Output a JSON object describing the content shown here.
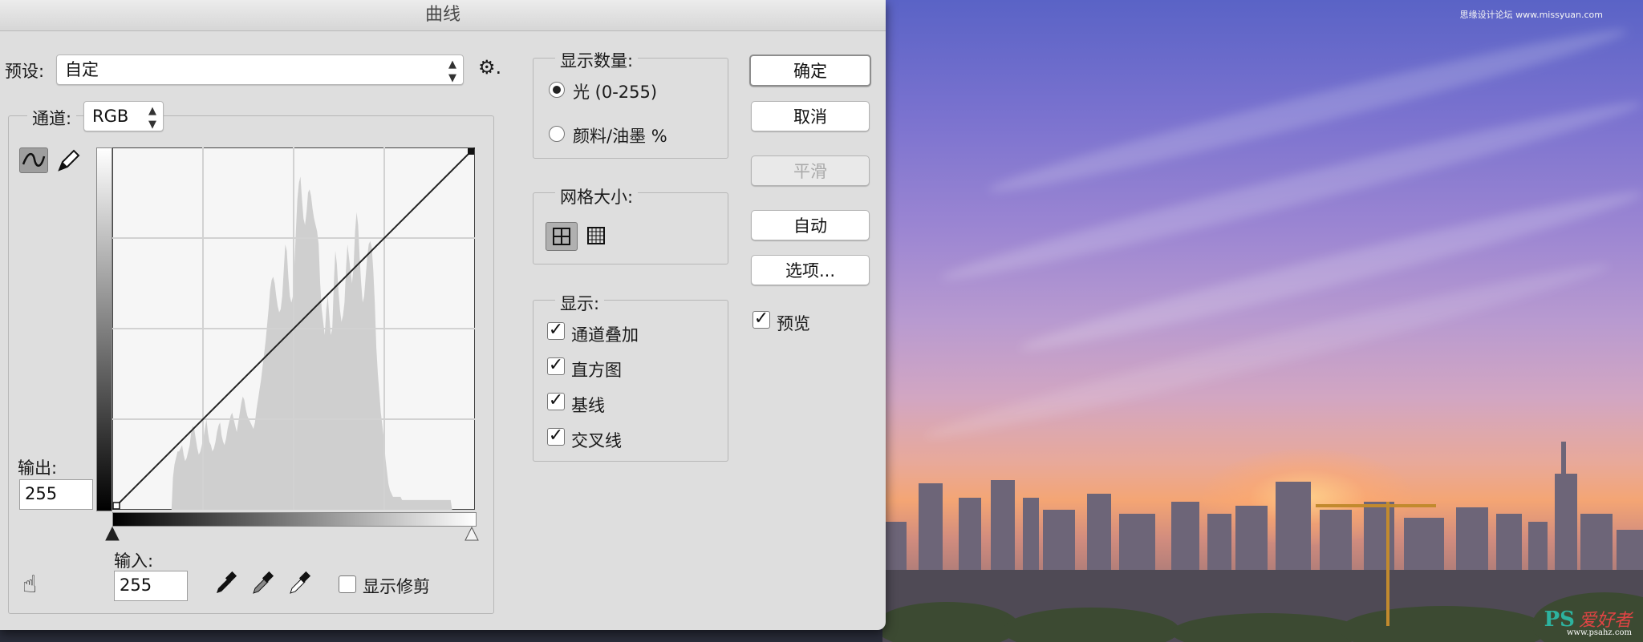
{
  "dialog": {
    "title": "曲线",
    "preset_label": "预设:",
    "preset_value": "自定",
    "channel_label": "通道:",
    "channel_value": "RGB",
    "output_label": "输出:",
    "output_value": "255",
    "input_label": "输入:",
    "input_value": "255",
    "show_clipping_label": "显示修剪",
    "show_clipping_checked": false
  },
  "display_amount": {
    "title": "显示数量:",
    "options": [
      {
        "label": "光 (0-255)",
        "selected": true
      },
      {
        "label": "颜料/油墨 %",
        "selected": false
      }
    ]
  },
  "grid_size": {
    "title": "网格大小:",
    "options": [
      "simple-grid-icon",
      "detailed-grid-icon"
    ],
    "selected": "simple-grid-icon"
  },
  "show": {
    "title": "显示:",
    "items": [
      {
        "label": "通道叠加",
        "checked": true
      },
      {
        "label": "直方图",
        "checked": true
      },
      {
        "label": "基线",
        "checked": true
      },
      {
        "label": "交叉线",
        "checked": true
      }
    ]
  },
  "buttons": {
    "ok": "确定",
    "cancel": "取消",
    "smooth": "平滑",
    "auto": "自动",
    "options": "选项...",
    "preview_label": "预览",
    "preview_checked": true
  },
  "watermark": {
    "top": "思缘设计论坛 www.missyuan.com",
    "brand_big": "PS",
    "brand_cn": "爱好者",
    "url": "www.psahz.com"
  },
  "histogram_levels": [
    0,
    0,
    0,
    0,
    0,
    0,
    0,
    0,
    0,
    0,
    0,
    0,
    0,
    0,
    0,
    0,
    0,
    0,
    0,
    0,
    0,
    0,
    0,
    0,
    0,
    0,
    0,
    0,
    0,
    0,
    0,
    0,
    0,
    0,
    0,
    0,
    0,
    0,
    0,
    0,
    10,
    14,
    16,
    18,
    18,
    19,
    20,
    17,
    15,
    16,
    18,
    20,
    24,
    26,
    25,
    22,
    19,
    17,
    18,
    20,
    22,
    25,
    28,
    24,
    21,
    20,
    18,
    19,
    21,
    24,
    26,
    27,
    23,
    21,
    20,
    22,
    25,
    27,
    29,
    30,
    28,
    26,
    24,
    27,
    30,
    33,
    35,
    34,
    31,
    29,
    28,
    27,
    26,
    25,
    27,
    31,
    34,
    37,
    40,
    44,
    48,
    52,
    57,
    62,
    68,
    71,
    72,
    70,
    66,
    63,
    61,
    62,
    66,
    74,
    82,
    80,
    72,
    66,
    64,
    66,
    75,
    86,
    96,
    101,
    103,
    96,
    90,
    88,
    92,
    98,
    99,
    97,
    93,
    90,
    88,
    86,
    82,
    70,
    62,
    58,
    54,
    62,
    66,
    60,
    54,
    56,
    70,
    80,
    76,
    68,
    62,
    58,
    60,
    64,
    74,
    82,
    78,
    74,
    70,
    75,
    86,
    92,
    88,
    78,
    70,
    64,
    66,
    72,
    78,
    82,
    83,
    81,
    74,
    64,
    50,
    42,
    36,
    30,
    26,
    22,
    16,
    12,
    8,
    6,
    5,
    4,
    4,
    4,
    4,
    4,
    4,
    3,
    3,
    3,
    3,
    3,
    3,
    3,
    3,
    3,
    3,
    3,
    3,
    3,
    3,
    3,
    3,
    3,
    3,
    3,
    3,
    3,
    3,
    3,
    3,
    3,
    3,
    3,
    3,
    3,
    3,
    3,
    3,
    3,
    0,
    0,
    0,
    0,
    0,
    0,
    0,
    0,
    0,
    0,
    0,
    0,
    0,
    0,
    0,
    0
  ]
}
